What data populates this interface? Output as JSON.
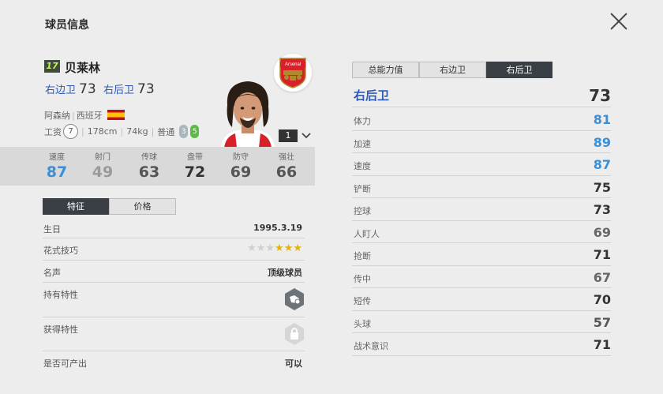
{
  "header": {
    "title": "球员信息"
  },
  "player": {
    "season_badge": "17",
    "name": "贝莱林",
    "positions": [
      {
        "label": "右边卫",
        "ovr": "73"
      },
      {
        "label": "右后卫",
        "ovr": "73"
      }
    ],
    "club": "阿森纳",
    "nation": "西班牙",
    "wage_label": "工资",
    "wage": "7",
    "height": "178cm",
    "weight": "74kg",
    "body_type": "普通",
    "weak_foot": "3",
    "strong_foot": "5",
    "club_badge_text": "Arsenal",
    "level": "1"
  },
  "summary_stats": [
    {
      "label": "速度",
      "value": "87",
      "color": "#3a8fd6"
    },
    {
      "label": "射门",
      "value": "49",
      "color": "#9a9a9a"
    },
    {
      "label": "传球",
      "value": "63",
      "color": "#555555"
    },
    {
      "label": "盘带",
      "value": "72",
      "color": "#333333"
    },
    {
      "label": "防守",
      "value": "69",
      "color": "#555555"
    },
    {
      "label": "强壮",
      "value": "66",
      "color": "#555555"
    }
  ],
  "left_tabs": {
    "traits": "特征",
    "price": "价格"
  },
  "info": {
    "birthday_label": "生日",
    "birthday": "1995.3.19",
    "skill_label": "花式技巧",
    "skill_stars": 3,
    "skill_max": 6,
    "fame_label": "名声",
    "fame": "顶级球员",
    "held_trait_label": "持有特性",
    "gained_trait_label": "获得特性",
    "producible_label": "是否可产出",
    "producible": "可以"
  },
  "right_tabs": [
    "总能力值",
    "右边卫",
    "右后卫"
  ],
  "position_rating": {
    "label": "右后卫",
    "value": "73"
  },
  "attributes": [
    {
      "label": "体力",
      "value": "81",
      "color": "#3a8fd6"
    },
    {
      "label": "加速",
      "value": "89",
      "color": "#3a8fd6"
    },
    {
      "label": "速度",
      "value": "87",
      "color": "#3a8fd6"
    },
    {
      "label": "铲断",
      "value": "75",
      "color": "#333333"
    },
    {
      "label": "控球",
      "value": "73",
      "color": "#333333"
    },
    {
      "label": "人盯人",
      "value": "69",
      "color": "#666666"
    },
    {
      "label": "抢断",
      "value": "71",
      "color": "#333333"
    },
    {
      "label": "传中",
      "value": "67",
      "color": "#666666"
    },
    {
      "label": "短传",
      "value": "70",
      "color": "#333333"
    },
    {
      "label": "头球",
      "value": "57",
      "color": "#555555"
    },
    {
      "label": "战术意识",
      "value": "71",
      "color": "#333333"
    }
  ]
}
